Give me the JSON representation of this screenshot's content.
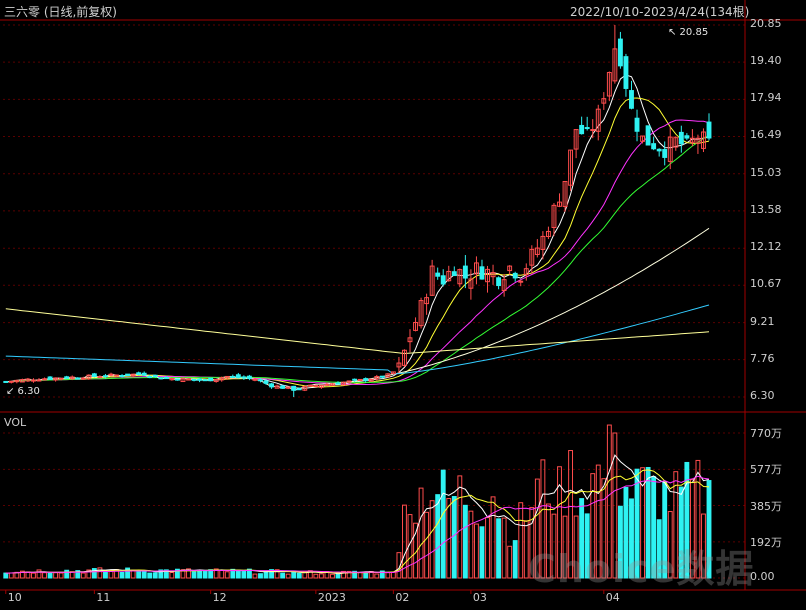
{
  "header": {
    "title": "三六零 (日线,前复权)",
    "range": "2022/10/10-2023/4/24(134根)"
  },
  "annotations": {
    "max": "↖ 20.85",
    "min": "↙ 6.30"
  },
  "watermark": "Choice数据",
  "colors": {
    "up": "#ff4d4d",
    "down": "#2ef2f2",
    "ma5": "#ffffff",
    "ma10": "#ffff33",
    "ma20": "#ff33ff",
    "ma30": "#33ff33",
    "ma60": "#ffffe0",
    "ma120": "#33ccff",
    "ma250": "#ffff99",
    "grid": "#5a0000"
  },
  "chart_data": [
    {
      "type": "candlestick",
      "title": "三六零 (日线,前复权)",
      "y_tick_labels": [
        "20.85",
        "19.40",
        "17.94",
        "16.49",
        "15.03",
        "13.58",
        "12.12",
        "10.67",
        "9.21",
        "7.76",
        "6.30"
      ],
      "ylim": [
        6.3,
        20.85
      ],
      "x_tick_labels": [
        "10",
        "11",
        "12",
        "2023",
        "02",
        "03",
        "04"
      ],
      "x_tick_positions": [
        0,
        16,
        37,
        56,
        70,
        84,
        108
      ],
      "n_bars": 134,
      "max_price": 20.85,
      "min_price": 6.3,
      "moving_averages": [
        "ma5",
        "ma10",
        "ma20",
        "ma30",
        "ma60",
        "ma120",
        "ma250"
      ],
      "close_anchors": [
        [
          0,
          6.9
        ],
        [
          5,
          7.0
        ],
        [
          10,
          7.05
        ],
        [
          15,
          7.1
        ],
        [
          20,
          7.15
        ],
        [
          25,
          7.2
        ],
        [
          28,
          7.05
        ],
        [
          32,
          7.0
        ],
        [
          36,
          6.95
        ],
        [
          40,
          7.1
        ],
        [
          45,
          7.0
        ],
        [
          48,
          6.75
        ],
        [
          52,
          6.6
        ],
        [
          56,
          6.75
        ],
        [
          60,
          6.85
        ],
        [
          64,
          6.95
        ],
        [
          67,
          7.05
        ],
        [
          69,
          7.15
        ],
        [
          71,
          7.4
        ],
        [
          73,
          8.7
        ],
        [
          75,
          9.8
        ],
        [
          77,
          11.2
        ],
        [
          79,
          10.9
        ],
        [
          81,
          11.4
        ],
        [
          83,
          11.0
        ],
        [
          85,
          11.3
        ],
        [
          87,
          11.2
        ],
        [
          89,
          11.0
        ],
        [
          91,
          11.4
        ],
        [
          93,
          11.1
        ],
        [
          95,
          11.8
        ],
        [
          97,
          12.5
        ],
        [
          99,
          13.6
        ],
        [
          101,
          14.8
        ],
        [
          103,
          16.8
        ],
        [
          105,
          16.5
        ],
        [
          107,
          17.3
        ],
        [
          109,
          19.1
        ],
        [
          110,
          20.0
        ],
        [
          111,
          19.6
        ],
        [
          113,
          17.5
        ],
        [
          115,
          16.4
        ],
        [
          117,
          16.2
        ],
        [
          119,
          16.0
        ],
        [
          121,
          16.3
        ],
        [
          123,
          16.1
        ],
        [
          125,
          16.5
        ],
        [
          127,
          16.2
        ]
      ],
      "line_endpoints": {
        "ma60": [
          [
            56,
            6.8
          ],
          [
            127,
            12.9
          ]
        ],
        "ma120": [
          [
            0,
            7.9
          ],
          [
            127,
            9.9
          ]
        ],
        "ma250": [
          [
            0,
            9.75
          ],
          [
            127,
            8.85
          ]
        ]
      }
    },
    {
      "type": "bar",
      "title": "VOL",
      "y_tick_labels": [
        "770万",
        "577万",
        "385万",
        "192万",
        "0.00"
      ],
      "ylim": [
        0,
        770
      ],
      "unit": "万",
      "volume_anchors": [
        [
          0,
          40
        ],
        [
          20,
          45
        ],
        [
          40,
          40
        ],
        [
          60,
          30
        ],
        [
          68,
          35
        ],
        [
          70,
          50
        ],
        [
          71,
          120
        ],
        [
          72,
          380
        ],
        [
          73,
          610
        ],
        [
          74,
          420
        ],
        [
          76,
          550
        ],
        [
          78,
          520
        ],
        [
          80,
          450
        ],
        [
          82,
          500
        ],
        [
          84,
          470
        ],
        [
          86,
          430
        ],
        [
          88,
          520
        ],
        [
          90,
          330
        ],
        [
          92,
          280
        ],
        [
          94,
          380
        ],
        [
          96,
          520
        ],
        [
          98,
          560
        ],
        [
          100,
          480
        ],
        [
          102,
          600
        ],
        [
          104,
          500
        ],
        [
          106,
          580
        ],
        [
          108,
          620
        ],
        [
          110,
          740
        ],
        [
          111,
          560
        ],
        [
          113,
          500
        ],
        [
          115,
          540
        ],
        [
          117,
          520
        ],
        [
          119,
          480
        ],
        [
          121,
          470
        ],
        [
          123,
          500
        ],
        [
          125,
          520
        ],
        [
          127,
          480
        ]
      ]
    }
  ]
}
